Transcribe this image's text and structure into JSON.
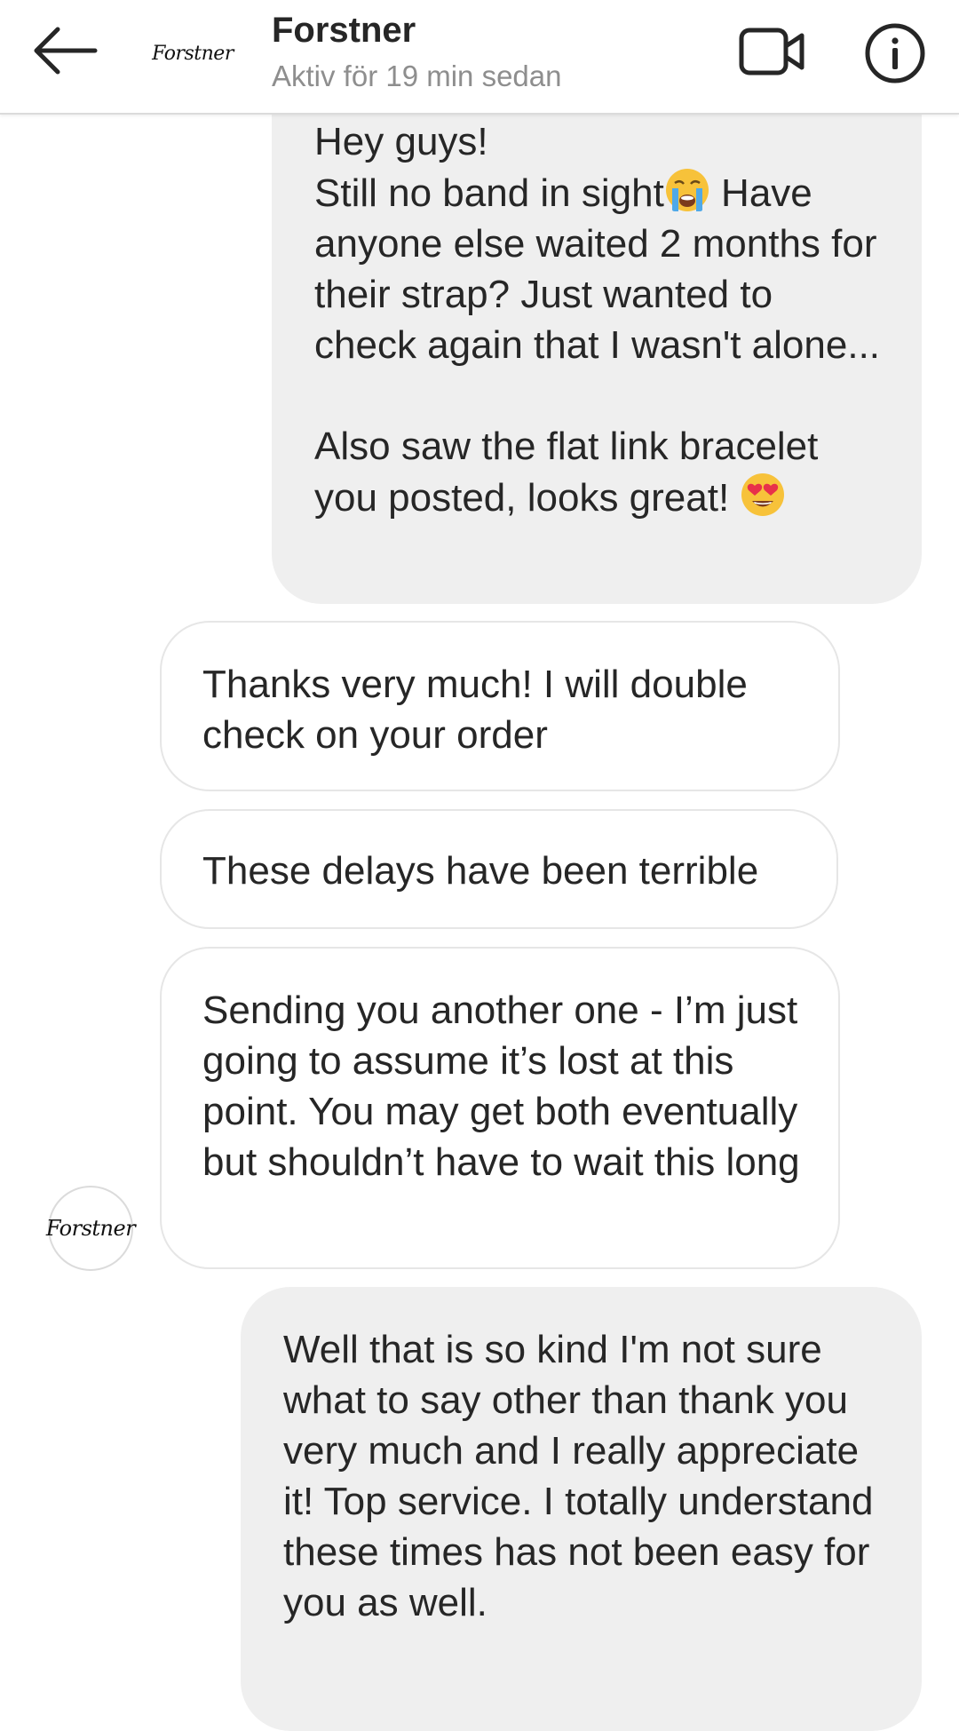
{
  "header": {
    "contact_name": "Forstner",
    "status": "Aktiv för 19 min sedan",
    "avatar_logo": "Forstner"
  },
  "icons": {
    "back": "arrow-left-icon",
    "video": "video-camera-icon",
    "info": "info-circle-icon",
    "crying_emoji": "loudly-crying-face",
    "heart_eyes_emoji": "smiling-face-with-heart-eyes"
  },
  "colors": {
    "outgoing_bubble": "#efefef",
    "incoming_border": "#e6e6e6",
    "secondary_text": "#8e8e8e"
  },
  "messages": [
    {
      "direction": "outgoing",
      "text_a": "Hey guys!\nStill no band in sight",
      "text_b": " Have anyone else waited 2 months for their strap? Just wanted to check again that I wasn't alone...\n\nAlso saw the flat link bracelet you posted, looks great! "
    },
    {
      "direction": "incoming",
      "text": "Thanks very much! I will double check on your order"
    },
    {
      "direction": "incoming",
      "text": "These delays have been terrible"
    },
    {
      "direction": "incoming",
      "text": "Sending you another one - I’m just going to assume it’s lost at this point. You may get both eventually but shouldn’t have to wait this long"
    },
    {
      "direction": "outgoing",
      "text": "Well that is so kind I'm not sure what to say other than thank you very much and I really appreciate it! Top service. I totally understand these times has not been easy for you as well."
    }
  ],
  "message_avatar_logo": "Forstner"
}
